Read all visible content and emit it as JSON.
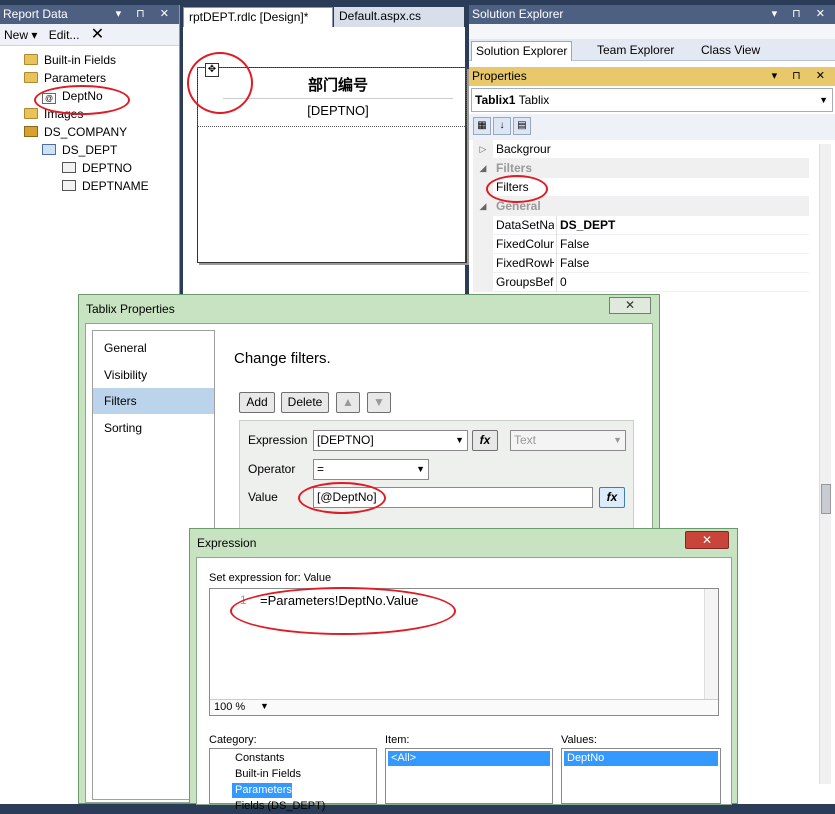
{
  "report_data": {
    "title": "Report Data",
    "controls": "▾ ⊓ ✕",
    "toolbar": {
      "new": "New ▾",
      "edit": "Edit...",
      "delete": "✕"
    },
    "tree": {
      "builtin": "Built-in Fields",
      "parameters": "Parameters",
      "param_deptno": "DeptNo",
      "images": "Images",
      "dataset_company": "DS_COMPANY",
      "dataset_dept": "DS_DEPT",
      "field_deptno": "DEPTNO",
      "field_deptname": "DEPTNAME"
    }
  },
  "designer": {
    "tab_active": "rptDEPT.rdlc [Design]*",
    "tab_inactive": "Default.aspx.cs",
    "header_cell": "部门编号",
    "data_cell": "[DEPTNO]"
  },
  "solution_explorer": {
    "title": "Solution Explorer",
    "controls": "▾ ⊓ ✕",
    "tabs": [
      "Solution Explorer",
      "Team Explorer",
      "Class View"
    ]
  },
  "properties": {
    "title": "Properties",
    "controls": "▾ ⊓ ✕",
    "object": "Tablix1",
    "object_type": "Tablix",
    "rows": [
      {
        "name": "Backgrour",
        "value": "",
        "cat": false,
        "expand": "▷"
      },
      {
        "name": "Filters",
        "value": "",
        "cat": true,
        "expand": "◢"
      },
      {
        "name": "Filters",
        "value": "",
        "cat": false,
        "expand": ""
      },
      {
        "name": "General",
        "value": "",
        "cat": true,
        "expand": "◢"
      },
      {
        "name": "DataSetNa",
        "value": "DS_DEPT",
        "cat": false,
        "expand": ""
      },
      {
        "name": "FixedColur",
        "value": "False",
        "cat": false,
        "expand": ""
      },
      {
        "name": "FixedRowH",
        "value": "False",
        "cat": false,
        "expand": ""
      },
      {
        "name": "GroupsBef",
        "value": "0",
        "cat": false,
        "expand": ""
      }
    ]
  },
  "tablix_dialog": {
    "title": "Tablix Properties",
    "close": "✕",
    "nav": [
      "General",
      "Visibility",
      "Filters",
      "Sorting"
    ],
    "heading": "Change filters.",
    "buttons": {
      "add": "Add",
      "delete": "Delete",
      "up": "▲",
      "down": "▼"
    },
    "expression_label": "Expression",
    "expression_value": "[DEPTNO]",
    "type_value": "Text",
    "operator_label": "Operator",
    "operator_value": "=",
    "value_label": "Value",
    "value_value": "[@DeptNo]",
    "fx": "fx"
  },
  "expression_dialog": {
    "title": "Expression",
    "close": "✕",
    "set_for": "Set expression for: Value",
    "line_number": "1",
    "expression": "=Parameters!DeptNo.Value",
    "zoom": "100 %",
    "category_label": "Category:",
    "item_label": "Item:",
    "values_label": "Values:",
    "categories": [
      "Constants",
      "Built-in Fields",
      "Parameters",
      "Fields (DS_DEPT)"
    ],
    "items": [
      "<All>"
    ],
    "values": [
      "DeptNo"
    ]
  }
}
